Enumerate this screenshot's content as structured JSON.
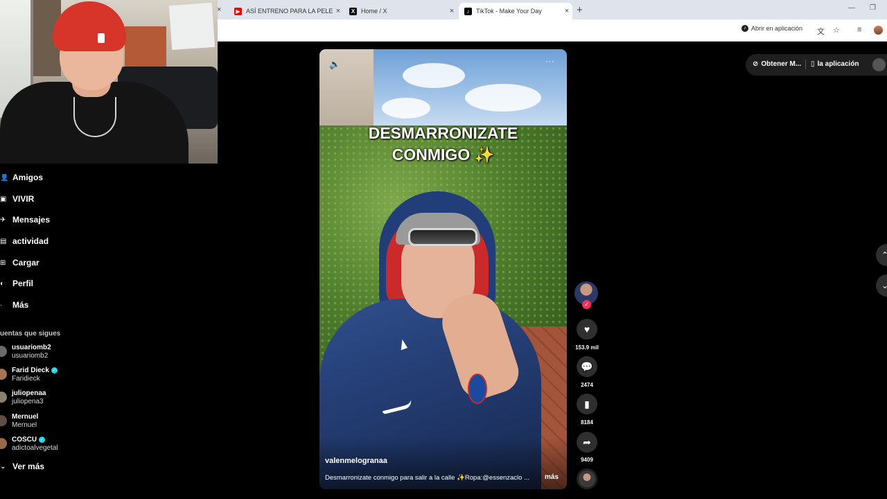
{
  "browser": {
    "tabs": [
      {
        "label": "ASÍ ENTRENO PARA LA PELEA c",
        "favicon": "youtube-icon",
        "active": false
      },
      {
        "label": "Home / X",
        "favicon": "x-icon",
        "active": false
      },
      {
        "label": "TikTok - Make Your Day",
        "favicon": "tiktok-icon",
        "active": true
      }
    ],
    "open_in_app": "Abrir en aplicación"
  },
  "sidebar": {
    "nav": [
      {
        "label": "Amigos",
        "icon": "user-icon"
      },
      {
        "label": "VIVIR",
        "icon": "live-icon"
      },
      {
        "label": "Mensajes",
        "icon": "messages-icon"
      },
      {
        "label": "actividad",
        "icon": "activity-icon"
      },
      {
        "label": "Cargar",
        "icon": "upload-icon"
      },
      {
        "label": "Perfil",
        "icon": "profile-icon"
      },
      {
        "label": "Más",
        "icon": "more-icon"
      }
    ],
    "following_title": "uentas que sigues",
    "following": [
      {
        "name": "usuariomb2",
        "handle": "usuariomb2",
        "verified": false
      },
      {
        "name": "Farid Dieck",
        "handle": "Faridieck",
        "verified": true
      },
      {
        "name": "juliopenaa",
        "handle": "juliopena3",
        "verified": false
      },
      {
        "name": "Mernuel",
        "handle": "Mernuel",
        "verified": false
      },
      {
        "name": "COSCU",
        "handle": "adictoalvegetal",
        "verified": true
      }
    ],
    "see_more": "Ver más"
  },
  "video": {
    "overlay_text": "DESMARRONIZATE\nCONMIGO ✨",
    "author": "valenmelogranaa",
    "caption": "Desmarronizate conmigo para salir a la calle ✨Ropa:@essenzaclo ...",
    "caption_more": "más"
  },
  "actions": {
    "likes": "153.9 mil",
    "comments": "2474",
    "saves": "8184",
    "shares": "9409"
  },
  "header": {
    "get_coins": "Obtener M...",
    "get_app": "la aplicación"
  },
  "colors": {
    "tiktok_red": "#fe2c55",
    "verified": "#20d5ec",
    "youtube": "#ff0000"
  }
}
